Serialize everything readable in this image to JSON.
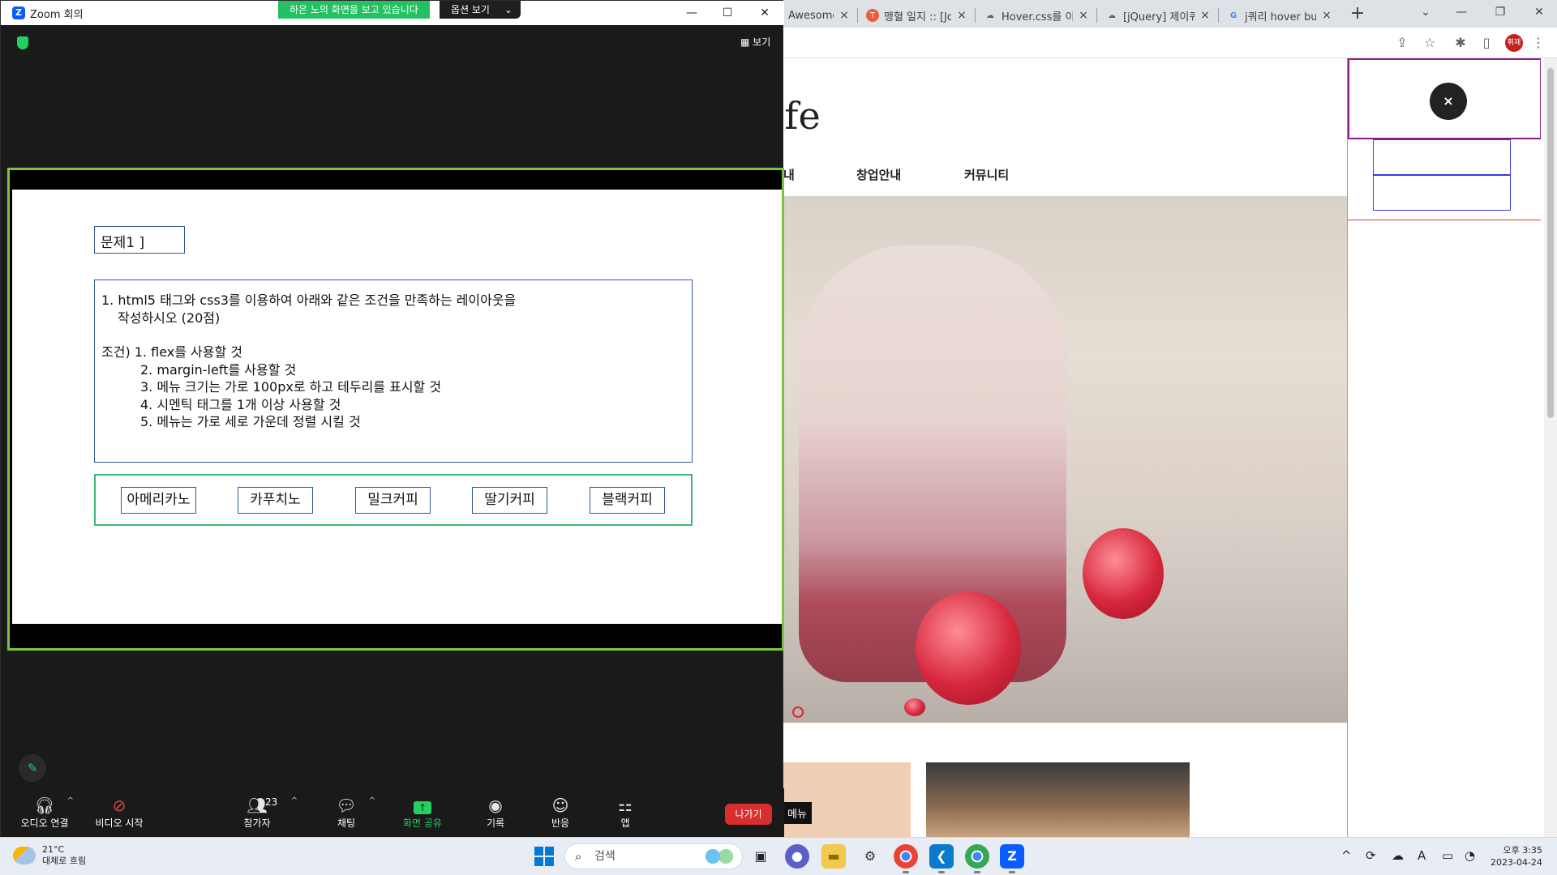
{
  "chrome": {
    "tabs": [
      {
        "title": "Awesome",
        "favicon": ""
      },
      {
        "title": "맹혈 일지 :: [Jq",
        "favicon": "T"
      },
      {
        "title": "Hover.css를 이",
        "favicon": "☁"
      },
      {
        "title": "[jQuery] 제이쿼",
        "favicon": "☁"
      },
      {
        "title": "j쿼리 hover bu",
        "favicon": "G"
      }
    ],
    "new_tab": "+",
    "profile_label": "휘재"
  },
  "site": {
    "logo": "afe",
    "nav": [
      "내",
      "창업안내",
      "커뮤니티"
    ],
    "close_label": "×",
    "menu_chip": "메뉴"
  },
  "zoom": {
    "window_title": "Zoom 회의",
    "share_banner": "하은 노의 화면을 보고 있습니다",
    "view_options": "옵션 보기",
    "view_label": "보기",
    "slide": {
      "question_title": "문제1 ]",
      "line1": "1. html5 태그와 css3를 이용하여 아래와 같은 조건을 만족하는 레이아웃을",
      "line2": "작성하시오 (20점)",
      "cond_prefix": "조건) 1. flex를 사용할 것",
      "conditions": [
        "2. margin-left를 사용할 것",
        "3. 메뉴 크기는 가로 100px로 하고 테두리를 표시할 것",
        "4. 시멘틱 태그를 1개 이상 사용할 것",
        "5. 메뉴는 가로 세로 가운데 정렬 시킬 것"
      ],
      "menu_items": [
        "아메리카노",
        "카푸치노",
        "밀크커피",
        "딸기커피",
        "블랙커피"
      ]
    },
    "toolbar": {
      "audio": "오디오 연결",
      "video": "비디오 시작",
      "participants": "참가자",
      "participants_count": "23",
      "chat": "채팅",
      "share": "화면 공유",
      "record": "기록",
      "reactions": "반응",
      "apps": "앱",
      "leave": "나가기"
    }
  },
  "taskbar": {
    "temp": "21°C",
    "weather": "대체로 흐림",
    "search_placeholder": "검색",
    "time": "오후 3:35",
    "date": "2023-04-24"
  },
  "colors": {
    "zoom_green": "#23d160",
    "share_border": "#7fc241",
    "leave_red": "#d92e2e",
    "slide_box_border": "#2f5597",
    "menu_box_border": "#3cb878"
  }
}
